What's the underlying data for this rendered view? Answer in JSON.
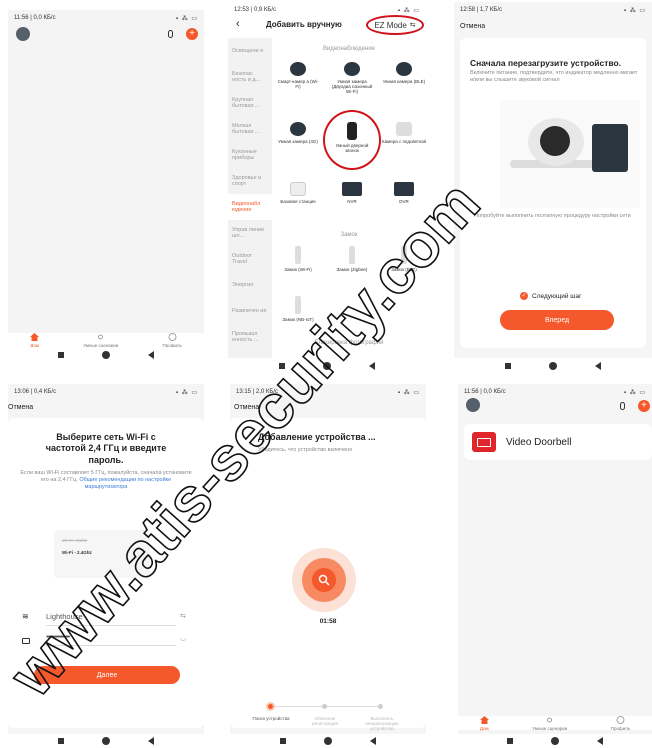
{
  "colors": {
    "accent": "#f5582a",
    "highlight_circle": "#d0121b"
  },
  "s1": {
    "status_time": "11:56 | 0,0 КБ/с",
    "status_right": "▪ ⁂ ▭",
    "tabs": [
      {
        "label": "Дом",
        "icon": "home-icon"
      },
      {
        "label": "Умные сценарии",
        "icon": "sun-icon"
      },
      {
        "label": "Профиль",
        "icon": "profile-icon"
      }
    ]
  },
  "s2": {
    "status_time": "12:53 | 0,9 КБ/с",
    "status_right": "▪ ⁂ ▭",
    "title": "Добавить вручную",
    "ez_mode": "EZ Mode",
    "sidebar": [
      "Освещени е",
      "Безопас ность и д...",
      "Крупная бытовая ...",
      "Мелкая бытовая ...",
      "Кухонные приборы",
      "Здоровье и спорт",
      "Видеонабл юдение",
      "Управ ление шл...",
      "Outdoor Travel",
      "Энергия",
      "Развлечен ия",
      "Промышл енность ..."
    ],
    "section1": "Видеонаблюдение",
    "devices": [
      "Смарт-камер а (Wi-Fi)",
      "Умная камера (Двухдиа пазонный Wi-Fi)",
      "Умная камера (BLE)",
      "Умная камера (4G)",
      "Умный дверной звонок",
      "Камера с подсветкой",
      "Базовая станция",
      "NVR",
      "DVR"
    ],
    "section2": "Замок",
    "locks": [
      "Замок (Wi-Fi)",
      "Замок (Zigbee)",
      "Замок (BLE)",
      "Замок (NB-IoT)"
    ],
    "section3": "Блокировка фотографий"
  },
  "s3": {
    "status_time": "12:58 | 1,7 КБ/с",
    "status_right": "▪ ⁂ ▭",
    "cancel": "Отмена",
    "heading": "Сначала перезагрузите устройство.",
    "body": "Включите питание, подтвердите, что индикатор медленно мигает и/или вы слышите звуковой сигнал",
    "hint": "Попробуйте выполнить поэтапную процедуру настройки сети",
    "next_step": "Следующий шаг",
    "button": "Вперед"
  },
  "s4": {
    "status_time": "13:06 | 0,4 КБ/с",
    "status_right": "▪ ⁂ ▭",
    "cancel": "Отмена",
    "heading": "Выберите сеть Wi-Fi с частотой 2,4 ГГц и введите пароль.",
    "body": "Если ваш Wi-Fi составляет 5 ГГц, пожалуйста, сначала установите его на 2,4 ГГц.",
    "link": "Общие рекомендации по настройке маршрутизатора",
    "wifi_5g": "Wi-Fi - 5Ghz",
    "wifi_24": "Wi-Fi - 2.4Ghz",
    "ssid": "Lighthouse",
    "password": "••••••••••••••••",
    "button": "Далее"
  },
  "s5": {
    "status_time": "13:15 | 2,0 КБ/с",
    "status_right": "▪ ⁂ ▭",
    "cancel": "Отмена",
    "heading": "Добавление устройства ...",
    "body": "Убедитесь, что устройство включено",
    "timer": "01:58",
    "steps": [
      "Поиск устройства",
      "Облачная регистрация",
      "Выполнить инициализацию устройства"
    ]
  },
  "s6": {
    "status_time": "11:56 | 0,0 КБ/с",
    "status_right": "▪ ⁂ ▭",
    "device_name": "Video Doorbell",
    "tabs": [
      {
        "label": "Дом",
        "icon": "home-icon"
      },
      {
        "label": "Умные сценарии",
        "icon": "sun-icon"
      },
      {
        "label": "Профиль",
        "icon": "profile-icon"
      }
    ]
  },
  "watermark": "www.atis-security.com"
}
